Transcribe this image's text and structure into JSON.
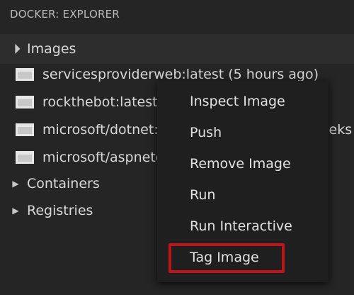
{
  "panel": {
    "title": "DOCKER: EXPLORER"
  },
  "images_section": {
    "label": "Images",
    "items": [
      {
        "label": "servicesproviderweb:latest (5 hours ago)"
      },
      {
        "label": "rockthebot:latest (5 hours ago)"
      },
      {
        "label": "microsoft/dotnet:1.0.0-preview2-sdk (4 weeks ago)"
      },
      {
        "label": "microsoft/aspnetcore:1.0.1 (4 weeks ago)"
      }
    ]
  },
  "groups": [
    {
      "label": "Containers"
    },
    {
      "label": "Registries"
    }
  ],
  "context_menu": {
    "items": [
      {
        "label": "Inspect Image"
      },
      {
        "label": "Push"
      },
      {
        "label": "Remove Image"
      },
      {
        "label": "Run"
      },
      {
        "label": "Run Interactive"
      },
      {
        "label": "Tag Image"
      }
    ],
    "highlighted": "Tag Image"
  },
  "colors": {
    "background": "#252526",
    "section_header": "#2d2d2e",
    "menu_background": "#1f1f1f",
    "highlight_border": "#c0141c"
  }
}
